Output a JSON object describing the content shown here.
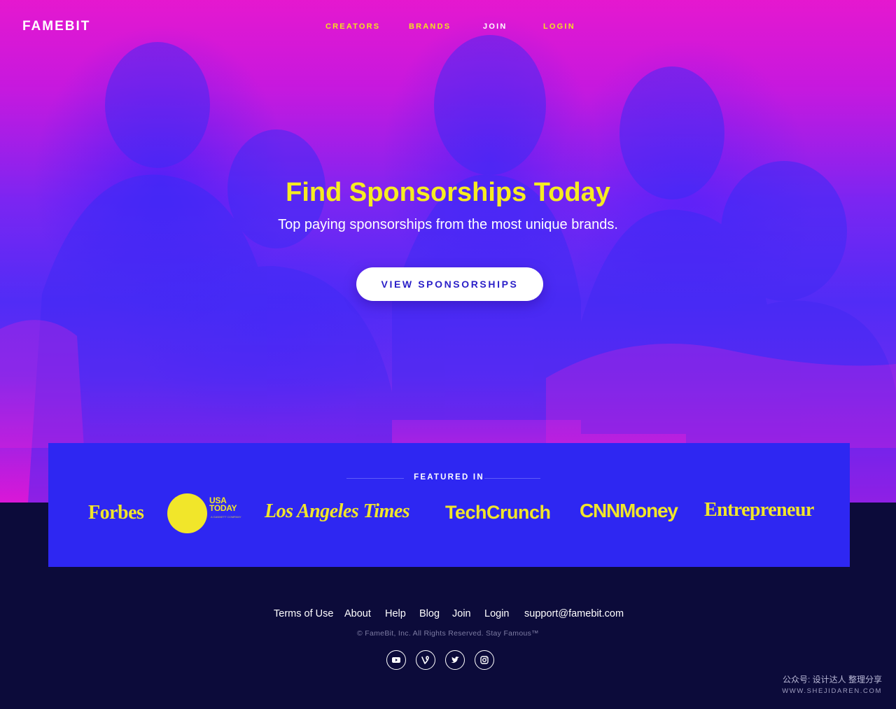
{
  "brand": {
    "logo": "FAMEBIT"
  },
  "nav": {
    "items": [
      "CREATORS",
      "BRANDS",
      "JOIN",
      "LOGIN"
    ]
  },
  "hero": {
    "headline": "Find Sponsorships Today",
    "subhead": "Top paying sponsorships from the most unique brands.",
    "cta": "VIEW SPONSORSHIPS"
  },
  "featured": {
    "title": "FEATURED IN",
    "logos": {
      "forbes": "Forbes",
      "usa_today_line1": "USA",
      "usa_today_line2": "TODAY",
      "usa_today_small": "A GANNETT COMPANY",
      "la_times": "Los Angeles Times",
      "techcrunch": "TechCrunch",
      "cnn_money": "CNNMoney",
      "entrepreneur": "Entrepreneur"
    }
  },
  "footer": {
    "links": [
      "Terms of Use",
      "About",
      "Help",
      "Blog",
      "Join",
      "Login",
      "support@famebit.com"
    ],
    "copyright": "© FameBit, Inc. All Rights Reserved. Stay Famous™",
    "social_icons": [
      "youtube-icon",
      "vine-icon",
      "twitter-icon",
      "instagram-icon"
    ]
  },
  "watermark": {
    "line1": "公众号: 设计达人 整理分享",
    "line2": "WWW.SHEJIDAREN.COM"
  },
  "colors": {
    "accent_yellow": "#f4e21d",
    "hero_magenta": "#e21ad0",
    "hero_blue": "#4a2ef8",
    "featured_bg": "#2e27f2",
    "footer_bg": "#0c0b3a",
    "cta_text": "#2a1fc8"
  }
}
